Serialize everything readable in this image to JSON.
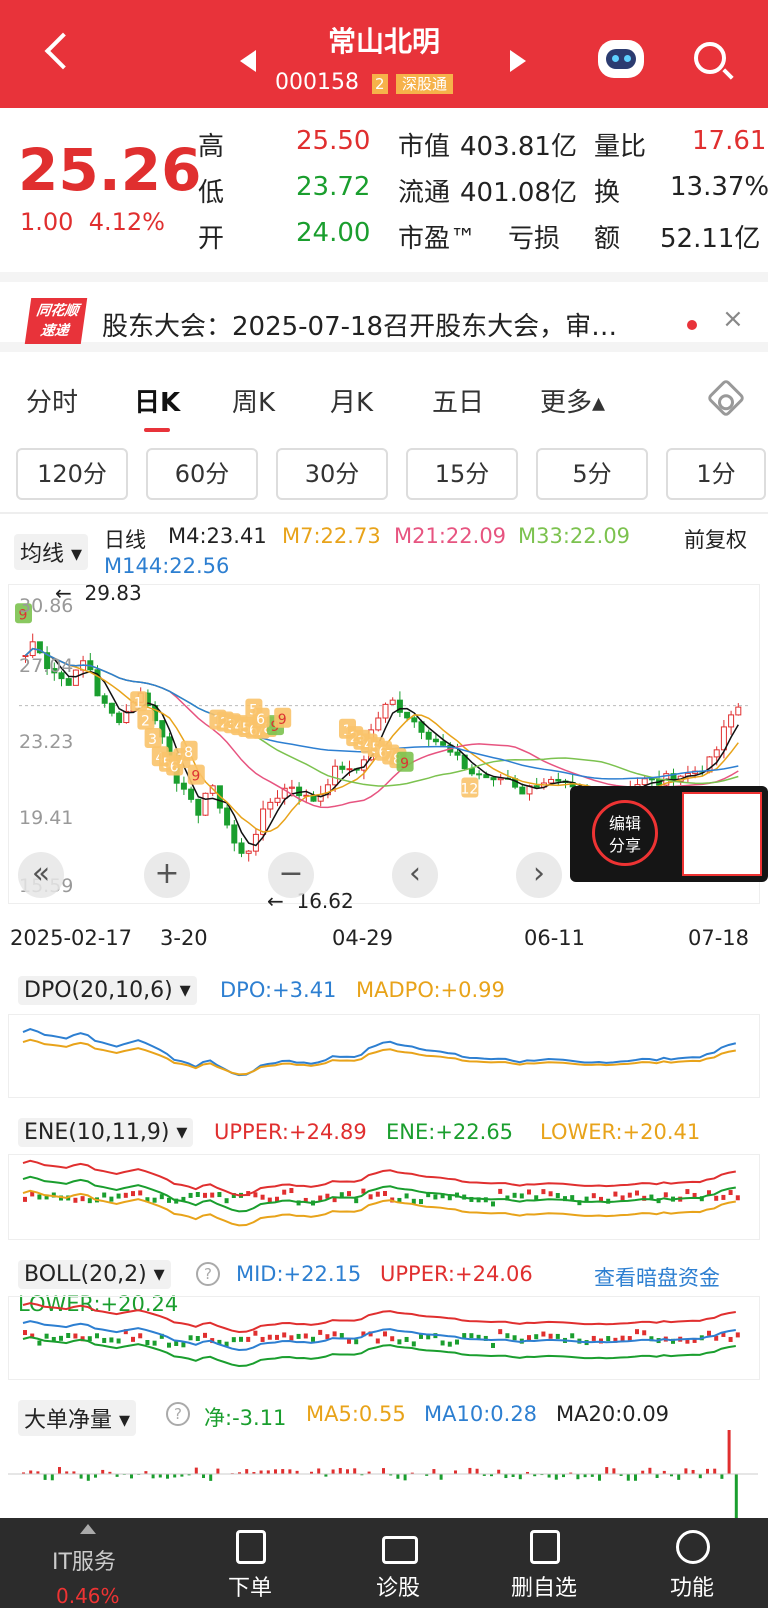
{
  "header": {
    "title": "常山北明",
    "code": "000158",
    "badge": "2",
    "tag": "深股通"
  },
  "quote": {
    "price": "25.26",
    "change": "1.00",
    "change_pct": "4.12%",
    "rows": [
      {
        "l1": "高",
        "v1": "25.50",
        "l2": "市值",
        "v2": "403.81亿",
        "l3": "量比",
        "v3": "17.61"
      },
      {
        "l1": "低",
        "v1": "23.72",
        "l2": "流通",
        "v2": "401.08亿",
        "l3": "换",
        "v3": "13.37%"
      },
      {
        "l1": "开",
        "v1": "24.00",
        "l2": "市盈™",
        "v2": "亏损",
        "l3": "额",
        "v3": "52.11亿"
      }
    ]
  },
  "notice": {
    "logo_top": "同花顺",
    "logo_bottom": "速递",
    "text": "股东大会：2025-07-18召开股东大会，审…",
    "close": "×"
  },
  "tabs": [
    "分时",
    "日K",
    "周K",
    "月K",
    "五日",
    "更多▴"
  ],
  "periods": [
    "120分",
    "60分",
    "30分",
    "15分",
    "5分",
    "1分"
  ],
  "ma": {
    "selector": "均线 ▾",
    "kind": "日线",
    "m4": "M4:23.41",
    "m7": "M7:22.73",
    "m21": "M21:22.09",
    "m33": "M33:22.09",
    "m144": "M144:22.56",
    "adjust": "前复权"
  },
  "colors": {
    "red": "#e02f2f",
    "green": "#1a9e2e",
    "blue": "#2d7fd1",
    "orange": "#e8a31a",
    "pink": "#e75480",
    "lgreen": "#7cc24f"
  },
  "kchart": {
    "y_ticks": [
      "30.86",
      "27.04",
      "23.23",
      "19.41",
      "15.59"
    ],
    "high_label": "29.83",
    "low_label": "16.62",
    "x_ticks": [
      "2025-02-17",
      "3-20",
      "04-29",
      "06-11",
      "07-18"
    ],
    "signals": [
      "9",
      "1",
      "2",
      "3",
      "4",
      "5",
      "6",
      "7",
      "8",
      "9",
      "1",
      "2",
      "3",
      "4",
      "5",
      "6",
      "7",
      "8",
      "9",
      "5",
      "6",
      "9",
      "1",
      "2",
      "3",
      "4",
      "5",
      "6",
      "7",
      "8",
      "9",
      "12"
    ]
  },
  "controls": [
    "«",
    "+",
    "−",
    "‹",
    "›"
  ],
  "share": {
    "label1": "编辑",
    "label2": "分享"
  },
  "dpo": {
    "selector": "DPO(20,10,6) ▾",
    "dpo": "DPO:+3.41",
    "madpo": "MADPO:+0.99"
  },
  "ene": {
    "selector": "ENE(10,11,9) ▾",
    "upper": "UPPER:+24.89",
    "ene": "ENE:+22.65",
    "lower": "LOWER:+20.41"
  },
  "boll": {
    "selector": "BOLL(20,2) ▾",
    "mid": "MID:+22.15",
    "upper": "UPPER:+24.06",
    "lower": "LOWER:+20.24",
    "link": "查看暗盘资金"
  },
  "bigorder": {
    "selector": "大单净量 ▾",
    "net": "净:-3.11",
    "ma5": "MA5:0.55",
    "ma10": "MA10:0.28",
    "ma20": "MA20:0.09"
  },
  "footer": {
    "service": "IT服务",
    "service_pct": "0.46%",
    "items": [
      "下单",
      "诊股",
      "删自选",
      "功能"
    ]
  }
}
